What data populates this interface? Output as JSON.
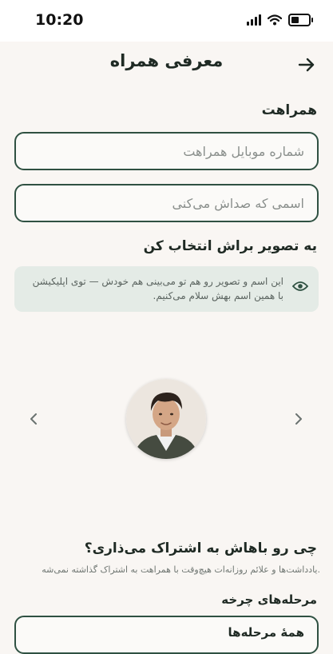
{
  "status_bar": {
    "time": "10:20"
  },
  "header": {
    "title": "معرفی همراه"
  },
  "partner": {
    "section_label": "همراهت",
    "phone_placeholder": "شماره موبایل همراهت",
    "name_placeholder": "اسمی که صداش می‌کنی"
  },
  "avatar_section": {
    "title": "یه تصویر براش انتخاب کن",
    "info": "این اسم و تصویر رو هم تو می‌بینی هم خودش — توی اپلیکیشن با همین اسم بهش سلام می‌کنیم."
  },
  "share": {
    "title": "چی رو باهاش به اشتراک می‌ذاری؟",
    "subtitle": "یادداشت‌ها و علائم روزانه‌ات هیچ‌وقت با همراهت به اشتراک گذاشته نمی‌شه.",
    "cycle_label": "مرحله‌های چرخه",
    "cycle_value": "همهٔ مرحله‌ها"
  },
  "colors": {
    "accent": "#2f5142",
    "background": "#f9f6f3",
    "info_bg": "#e4ebe6"
  }
}
